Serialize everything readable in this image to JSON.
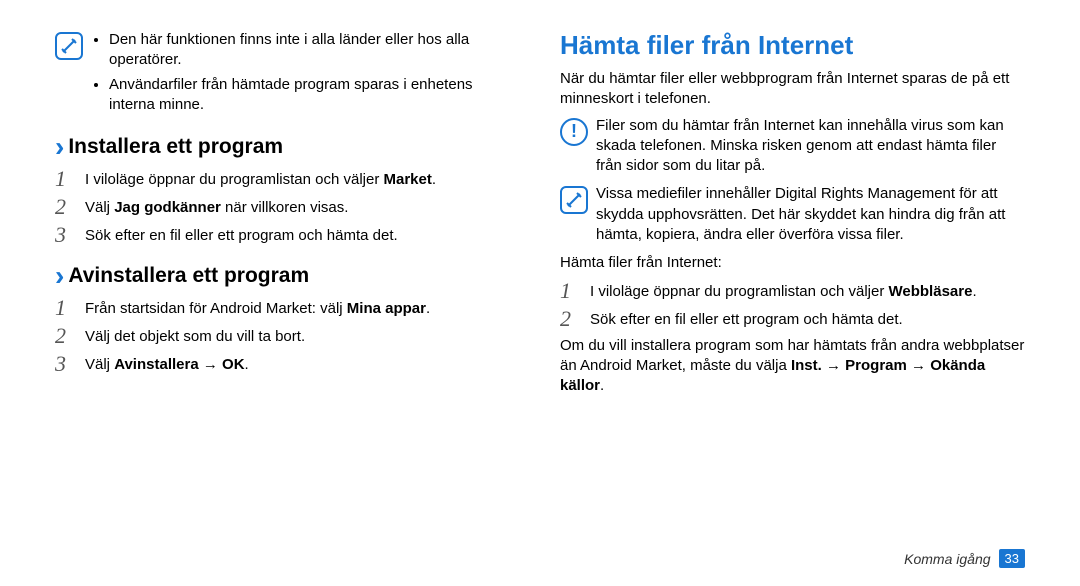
{
  "left": {
    "note1_li1": "Den här funktionen finns inte i alla länder eller hos alla operatörer.",
    "note1_li2": "Användarfiler från hämtade program sparas i enhetens interna minne.",
    "install_heading": "Installera ett program",
    "install_s1_a": "I viloläge öppnar du programlistan och väljer ",
    "install_s1_b": "Market",
    "install_s1_c": ".",
    "install_s2_a": "Välj ",
    "install_s2_b": "Jag godkänner",
    "install_s2_c": " när villkoren visas.",
    "install_s3": "Sök efter en fil eller ett program och hämta det.",
    "uninstall_heading": "Avinstallera ett program",
    "uninstall_s1_a": "Från startsidan för Android Market: välj ",
    "uninstall_s1_b": "Mina appar",
    "uninstall_s1_c": ".",
    "uninstall_s2": "Välj det objekt som du vill ta bort.",
    "uninstall_s3_a": "Välj ",
    "uninstall_s3_b": "Avinstallera",
    "uninstall_s3_c": " → ",
    "uninstall_s3_d": "OK",
    "uninstall_s3_e": "."
  },
  "right": {
    "title": "Hämta filer från Internet",
    "intro": "När du hämtar filer eller webbprogram från Internet sparas de på ett minneskort i telefonen.",
    "warn": "Filer som du hämtar från Internet kan innehålla virus som kan skada telefonen. Minska risken genom att endast hämta filer från sidor som du litar på.",
    "drm": "Vissa mediefiler innehåller Digital Rights Management för att skydda upphovsrätten. Det här skyddet kan hindra dig från att hämta, kopiera, ändra eller överföra vissa filer.",
    "intro2": "Hämta filer från Internet:",
    "s1_a": "I viloläge öppnar du programlistan och väljer ",
    "s1_b": "Webbläsare",
    "s1_c": ".",
    "s2": "Sök efter en fil eller ett program och hämta det.",
    "outro_a": "Om du vill installera program som har hämtats från andra webbplatser än Android Market, måste du välja ",
    "outro_b": "Inst.",
    "outro_c": " → ",
    "outro_d": "Program",
    "outro_e": " → ",
    "outro_f": "Okända källor",
    "outro_g": "."
  },
  "footer": {
    "section": "Komma igång",
    "page": "33"
  }
}
